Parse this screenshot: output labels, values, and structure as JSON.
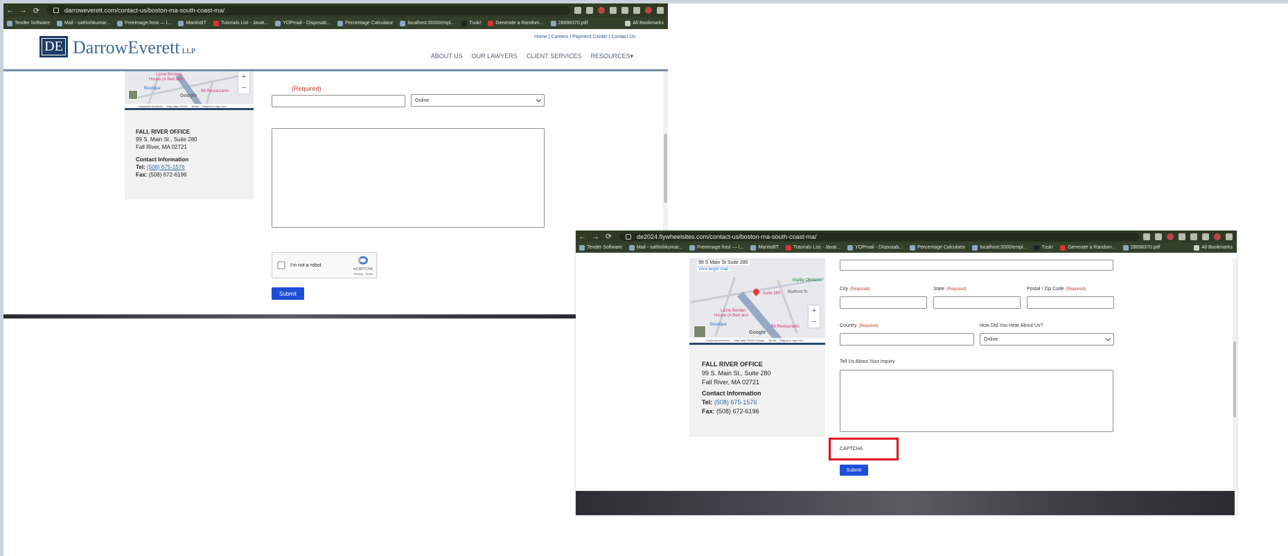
{
  "win1": {
    "url": "darroweverett.com/contact-us/boston-ma-south-coast-ma/",
    "nav_back": "←",
    "nav_forward": "→",
    "nav_reload": "⟳",
    "bookmarks": [
      "Tender Software",
      "Mail - sathishkumar...",
      "Freeimage.host — I...",
      "MantisBT",
      "Tutorials List - Javat...",
      "YOPmail - Disposab...",
      "Percentage Calculator",
      "localhost:3000/empl...",
      "Tusk!",
      "Generate a Random...",
      "28898370.pdf"
    ],
    "all_bookmarks": "All Bookmarks",
    "logo_initials": "DE",
    "logo_name": "DarrowEverett",
    "logo_suffix": "LLP",
    "util_links": [
      "Home",
      "Careers",
      "Payment Center",
      "Contact Us"
    ],
    "util_sep": " | ",
    "nav": [
      "ABOUT US",
      "OUR LAWYERS",
      "CLIENT SERVICES",
      "RESOURCES▾"
    ],
    "map": {
      "poi1": "Lizzie Borden",
      "poi2": "House (A Bed and",
      "poi3": "99 Restaurants",
      "poi4": "Boutique",
      "brand": "Google",
      "foot": [
        "Keyboard shortcuts",
        "Map data ©2024",
        "Terms",
        "Report a map error"
      ],
      "zoom_in": "+",
      "zoom_out": "−"
    },
    "office": {
      "title": "FALL RIVER OFFICE",
      "addr1": "99 S. Main St., Suite 280",
      "addr2": "Fall River, MA 02721",
      "contact_title": "Contact Information",
      "tel_label": "Tel:",
      "tel": "(508) 675-1576",
      "fax_label": "Fax:",
      "fax": "(508) 672-6196"
    },
    "required": "(Required)",
    "hear_value": "Online",
    "recaptcha_label": "I'm not a robot",
    "recaptcha_brand": "reCAPTCHA",
    "recaptcha_privacy": "Privacy - Terms",
    "submit": "Submit"
  },
  "win2": {
    "url": "de2024.flywheelsites.com/contact-us/boston-ma-south-coast-ma/",
    "nav_back": "←",
    "nav_forward": "→",
    "nav_reload": "⟳",
    "bookmarks": [
      "Tender Software",
      "Mail - sathishkumar...",
      "Freeimage.host — I...",
      "MantisBT",
      "Tutorials List - Javat...",
      "YOPmail - Disposab...",
      "Percentage Calculator",
      "localhost:3000/empl...",
      "Tusk!",
      "Generate a Random...",
      "28898370.pdf"
    ],
    "all_bookmarks": "All Bookmarks",
    "map": {
      "address": "99 S Main St Suite 280",
      "view_larger": "View larger map",
      "poi1": "Lizzie Borden",
      "poi2": "House (A Bed and",
      "poi3": "99 Restaurants",
      "poi4": "Boutique",
      "poi5": "Vitality Obstacle",
      "pin_label": "Suite 280",
      "street": "Bedford St",
      "brand": "Google",
      "foot": [
        "Keyboard shortcuts",
        "Map data ©2024 Google",
        "Terms",
        "Report a map error"
      ],
      "zoom_in": "+",
      "zoom_out": "−"
    },
    "office": {
      "title": "FALL RIVER OFFICE",
      "addr1": "99 S. Main St., Suite 280",
      "addr2": "Fall River, MA 02721",
      "contact_title": "Contact Information",
      "tel_label": "Tel:",
      "tel": "(508) 675-1576",
      "fax_label": "Fax:",
      "fax": "(508) 672-6196"
    },
    "fields": {
      "city": "City",
      "state": "State",
      "zip": "Postal / Zip Code",
      "country": "Country",
      "hear": "How Did You Hear About Us?",
      "inquiry": "Tell Us About Your Inquiry",
      "required": "(Required)"
    },
    "hear_value": "Online",
    "captcha": "CAPTCHA",
    "submit": "Submit"
  }
}
